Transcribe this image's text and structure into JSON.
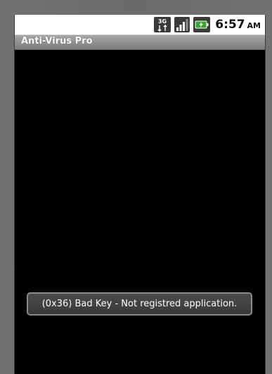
{
  "status_bar": {
    "network_type": "3G",
    "time": "6:57",
    "ampm": "AM",
    "icons": [
      "network-3g-icon",
      "signal-strength-icon",
      "battery-charging-icon"
    ]
  },
  "app": {
    "title": "Anti-Virus Pro"
  },
  "toast": {
    "message": "(0x36) Bad Key - Not registred application."
  },
  "colors": {
    "status_bar_bg": "#ffffff",
    "title_bar_bg": "#8f8f8f",
    "screen_bg": "#000000",
    "toast_bg": "#3f3f3f",
    "toast_border": "#8a8a8a",
    "battery_green": "#3aa530"
  }
}
